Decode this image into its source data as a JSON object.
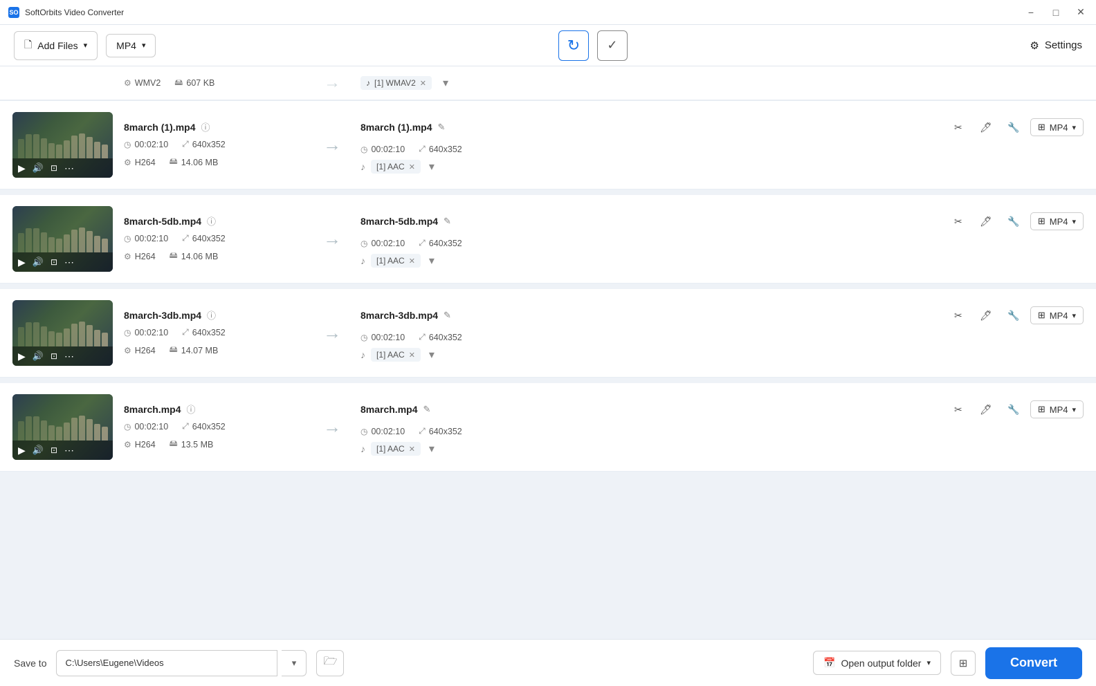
{
  "app": {
    "title": "SoftOrbits Video Converter",
    "icon": "SO"
  },
  "titlebar": {
    "minimize": "−",
    "maximize": "□",
    "close": "✕"
  },
  "toolbar": {
    "add_files": "Add Files",
    "format": "MP4",
    "settings": "Settings"
  },
  "files": [
    {
      "id": "partial",
      "name": "",
      "duration": "",
      "resolution": "",
      "codec": "WMV2",
      "size": "607 KB",
      "output_name": "",
      "output_format": "WMAV2",
      "partial": true
    },
    {
      "id": "file1",
      "name": "8march (1).mp4",
      "duration": "00:02:10",
      "resolution": "640x352",
      "codec": "H264",
      "size": "14.06 MB",
      "output_name": "8march (1).mp4",
      "output_duration": "00:02:10",
      "output_resolution": "640x352",
      "output_format": "MP4",
      "audio_track": "[1] AAC",
      "partial": false
    },
    {
      "id": "file2",
      "name": "8march-5db.mp4",
      "duration": "00:02:10",
      "resolution": "640x352",
      "codec": "H264",
      "size": "14.06 MB",
      "output_name": "8march-5db.mp4",
      "output_duration": "00:02:10",
      "output_resolution": "640x352",
      "output_format": "MP4",
      "audio_track": "[1] AAC",
      "partial": false
    },
    {
      "id": "file3",
      "name": "8march-3db.mp4",
      "duration": "00:02:10",
      "resolution": "640x352",
      "codec": "H264",
      "size": "14.07 MB",
      "output_name": "8march-3db.mp4",
      "output_duration": "00:02:10",
      "output_resolution": "640x352",
      "output_format": "MP4",
      "audio_track": "[1] AAC",
      "partial": false
    },
    {
      "id": "file4",
      "name": "8march.mp4",
      "duration": "00:02:10",
      "resolution": "640x352",
      "codec": "H264",
      "size": "13.5 MB",
      "output_name": "8march.mp4",
      "output_duration": "00:02:10",
      "output_resolution": "640x352",
      "output_format": "MP4",
      "audio_track": "[1] AAC",
      "partial": false
    }
  ],
  "bottom_bar": {
    "save_to_label": "Save to",
    "save_path": "C:\\Users\\Eugene\\Videos",
    "open_output_label": "Open output folder",
    "convert_label": "Convert"
  },
  "icons": {
    "add_files": "📄",
    "settings": "⚙",
    "refresh": "↻",
    "check": "✓",
    "arrow_right": "→",
    "edit": "✎",
    "crop": "⊡",
    "trim": "✂",
    "wrench": "🔧",
    "play": "▶",
    "volume": "🔊",
    "more": "⋯",
    "calendar": "📅",
    "folder": "📁",
    "grid": "⊞",
    "chevron_down": "▾",
    "music_note": "♪",
    "clock": "◷",
    "resize": "⤢",
    "gear": "⚙"
  }
}
